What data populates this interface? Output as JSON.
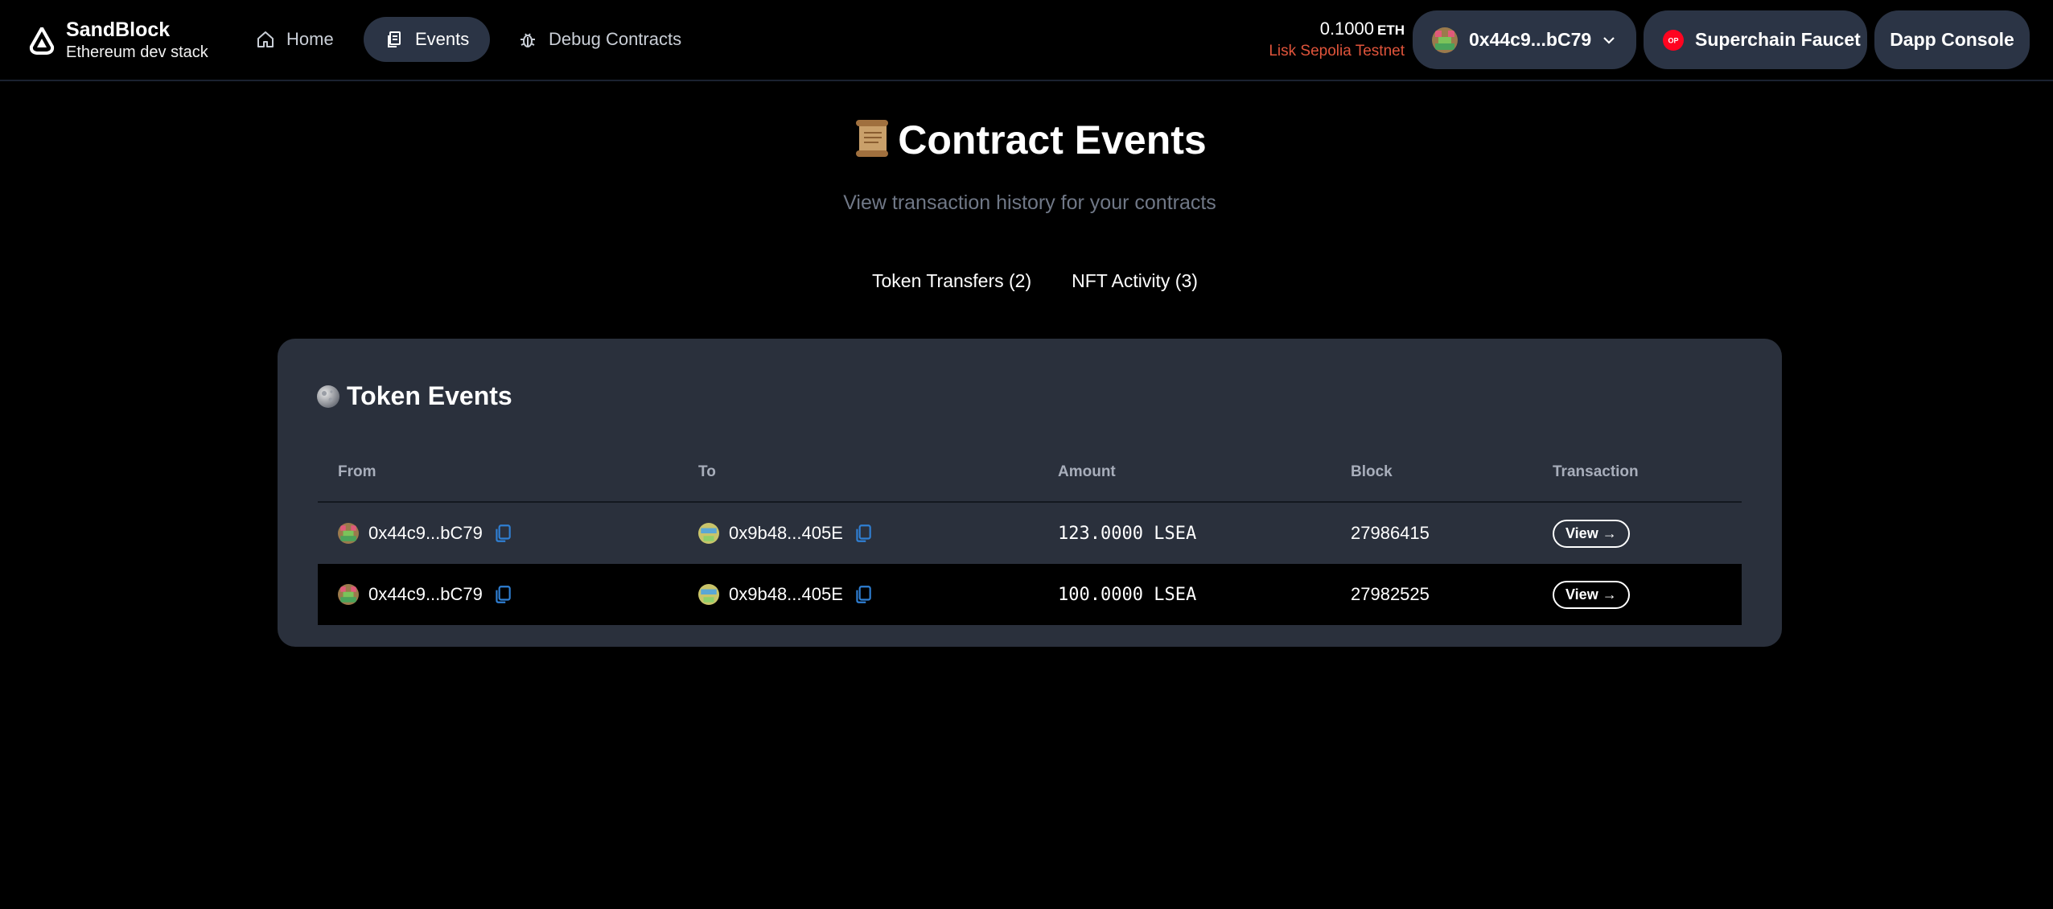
{
  "brand": {
    "title": "SandBlock",
    "subtitle": "Ethereum dev stack"
  },
  "nav": {
    "home": "Home",
    "events": "Events",
    "debug": "Debug Contracts"
  },
  "wallet": {
    "balance": "0.1000",
    "unit": "ETH",
    "network": "Lisk Sepolia Testnet",
    "address": "0x44c9...bC79"
  },
  "buttons": {
    "faucet": "Superchain Faucet",
    "console": "Dapp Console"
  },
  "page": {
    "title": "Contract Events",
    "subtitle": "View transaction history for your contracts"
  },
  "tabs": {
    "token": "Token Transfers (2)",
    "nft": "NFT Activity (3)"
  },
  "token_events": {
    "title": "Token Events",
    "columns": {
      "from": "From",
      "to": "To",
      "amount": "Amount",
      "block": "Block",
      "tx": "Transaction"
    },
    "rows": [
      {
        "from": "0x44c9...bC79",
        "to": "0x9b48...405E",
        "amount": "123.0000 LSEA",
        "block": "27986415",
        "view": "View →"
      },
      {
        "from": "0x44c9...bC79",
        "to": "0x9b48...405E",
        "amount": "100.0000 LSEA",
        "block": "27982525",
        "view": "View →"
      }
    ]
  },
  "colors": {
    "background": "#000000",
    "card": "#2a303c",
    "pill": "#2b3445",
    "network": "#e0543b",
    "copy_icon": "#2f7fd3"
  }
}
